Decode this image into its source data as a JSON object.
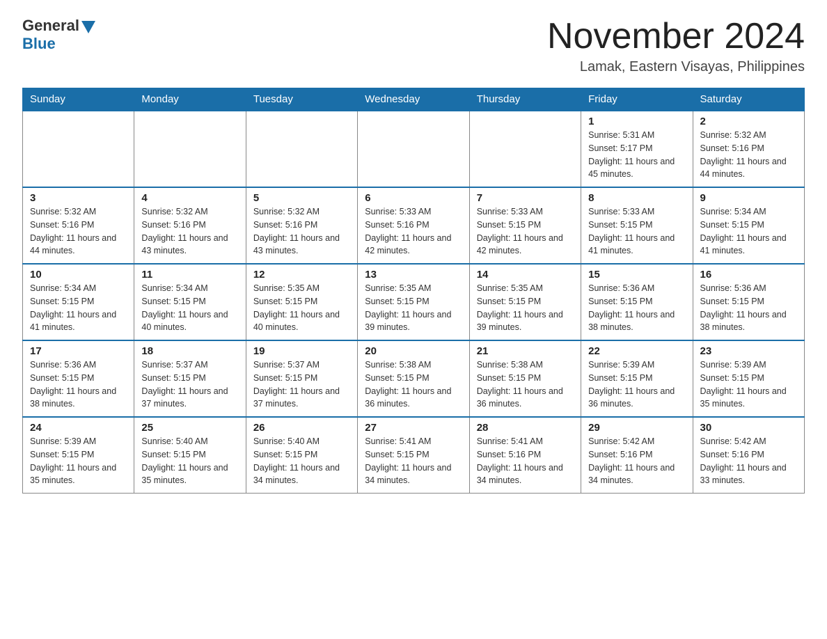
{
  "header": {
    "logo_general": "General",
    "logo_blue": "Blue",
    "month_title": "November 2024",
    "location": "Lamak, Eastern Visayas, Philippines"
  },
  "days_of_week": [
    "Sunday",
    "Monday",
    "Tuesday",
    "Wednesday",
    "Thursday",
    "Friday",
    "Saturday"
  ],
  "weeks": [
    [
      {
        "day": "",
        "info": ""
      },
      {
        "day": "",
        "info": ""
      },
      {
        "day": "",
        "info": ""
      },
      {
        "day": "",
        "info": ""
      },
      {
        "day": "",
        "info": ""
      },
      {
        "day": "1",
        "info": "Sunrise: 5:31 AM\nSunset: 5:17 PM\nDaylight: 11 hours and 45 minutes."
      },
      {
        "day": "2",
        "info": "Sunrise: 5:32 AM\nSunset: 5:16 PM\nDaylight: 11 hours and 44 minutes."
      }
    ],
    [
      {
        "day": "3",
        "info": "Sunrise: 5:32 AM\nSunset: 5:16 PM\nDaylight: 11 hours and 44 minutes."
      },
      {
        "day": "4",
        "info": "Sunrise: 5:32 AM\nSunset: 5:16 PM\nDaylight: 11 hours and 43 minutes."
      },
      {
        "day": "5",
        "info": "Sunrise: 5:32 AM\nSunset: 5:16 PM\nDaylight: 11 hours and 43 minutes."
      },
      {
        "day": "6",
        "info": "Sunrise: 5:33 AM\nSunset: 5:16 PM\nDaylight: 11 hours and 42 minutes."
      },
      {
        "day": "7",
        "info": "Sunrise: 5:33 AM\nSunset: 5:15 PM\nDaylight: 11 hours and 42 minutes."
      },
      {
        "day": "8",
        "info": "Sunrise: 5:33 AM\nSunset: 5:15 PM\nDaylight: 11 hours and 41 minutes."
      },
      {
        "day": "9",
        "info": "Sunrise: 5:34 AM\nSunset: 5:15 PM\nDaylight: 11 hours and 41 minutes."
      }
    ],
    [
      {
        "day": "10",
        "info": "Sunrise: 5:34 AM\nSunset: 5:15 PM\nDaylight: 11 hours and 41 minutes."
      },
      {
        "day": "11",
        "info": "Sunrise: 5:34 AM\nSunset: 5:15 PM\nDaylight: 11 hours and 40 minutes."
      },
      {
        "day": "12",
        "info": "Sunrise: 5:35 AM\nSunset: 5:15 PM\nDaylight: 11 hours and 40 minutes."
      },
      {
        "day": "13",
        "info": "Sunrise: 5:35 AM\nSunset: 5:15 PM\nDaylight: 11 hours and 39 minutes."
      },
      {
        "day": "14",
        "info": "Sunrise: 5:35 AM\nSunset: 5:15 PM\nDaylight: 11 hours and 39 minutes."
      },
      {
        "day": "15",
        "info": "Sunrise: 5:36 AM\nSunset: 5:15 PM\nDaylight: 11 hours and 38 minutes."
      },
      {
        "day": "16",
        "info": "Sunrise: 5:36 AM\nSunset: 5:15 PM\nDaylight: 11 hours and 38 minutes."
      }
    ],
    [
      {
        "day": "17",
        "info": "Sunrise: 5:36 AM\nSunset: 5:15 PM\nDaylight: 11 hours and 38 minutes."
      },
      {
        "day": "18",
        "info": "Sunrise: 5:37 AM\nSunset: 5:15 PM\nDaylight: 11 hours and 37 minutes."
      },
      {
        "day": "19",
        "info": "Sunrise: 5:37 AM\nSunset: 5:15 PM\nDaylight: 11 hours and 37 minutes."
      },
      {
        "day": "20",
        "info": "Sunrise: 5:38 AM\nSunset: 5:15 PM\nDaylight: 11 hours and 36 minutes."
      },
      {
        "day": "21",
        "info": "Sunrise: 5:38 AM\nSunset: 5:15 PM\nDaylight: 11 hours and 36 minutes."
      },
      {
        "day": "22",
        "info": "Sunrise: 5:39 AM\nSunset: 5:15 PM\nDaylight: 11 hours and 36 minutes."
      },
      {
        "day": "23",
        "info": "Sunrise: 5:39 AM\nSunset: 5:15 PM\nDaylight: 11 hours and 35 minutes."
      }
    ],
    [
      {
        "day": "24",
        "info": "Sunrise: 5:39 AM\nSunset: 5:15 PM\nDaylight: 11 hours and 35 minutes."
      },
      {
        "day": "25",
        "info": "Sunrise: 5:40 AM\nSunset: 5:15 PM\nDaylight: 11 hours and 35 minutes."
      },
      {
        "day": "26",
        "info": "Sunrise: 5:40 AM\nSunset: 5:15 PM\nDaylight: 11 hours and 34 minutes."
      },
      {
        "day": "27",
        "info": "Sunrise: 5:41 AM\nSunset: 5:15 PM\nDaylight: 11 hours and 34 minutes."
      },
      {
        "day": "28",
        "info": "Sunrise: 5:41 AM\nSunset: 5:16 PM\nDaylight: 11 hours and 34 minutes."
      },
      {
        "day": "29",
        "info": "Sunrise: 5:42 AM\nSunset: 5:16 PM\nDaylight: 11 hours and 34 minutes."
      },
      {
        "day": "30",
        "info": "Sunrise: 5:42 AM\nSunset: 5:16 PM\nDaylight: 11 hours and 33 minutes."
      }
    ]
  ]
}
